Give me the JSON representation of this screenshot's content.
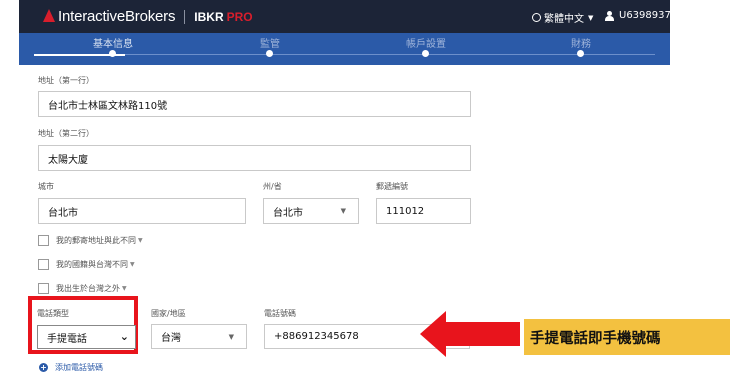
{
  "header": {
    "brand": "InteractiveBrokers",
    "product_a": "IBKR",
    "product_b": "PRO",
    "language": "繁體中文",
    "user_id": "U6398937"
  },
  "stepper": {
    "steps": [
      {
        "label": "基本信息",
        "state": "active"
      },
      {
        "label": "監管",
        "state": "pending"
      },
      {
        "label": "帳戶設置",
        "state": "pending"
      },
      {
        "label": "財務",
        "state": "pending"
      }
    ]
  },
  "form": {
    "address1": {
      "label": "地址（第一行）",
      "value": "台北市士林區文林路110號"
    },
    "address2": {
      "label": "地址（第二行）",
      "value": "太陽大廈"
    },
    "city": {
      "label": "城市",
      "value": "台北市"
    },
    "state": {
      "label": "州/省",
      "value": "台北市"
    },
    "postal": {
      "label": "郵遞編號",
      "value": "111012"
    },
    "checkboxes": [
      {
        "label": "我的郵寄地址與此不同",
        "checked": false
      },
      {
        "label": "我的國籍與台灣不同",
        "checked": false
      },
      {
        "label": "我出生於台灣之外",
        "checked": false
      }
    ],
    "phone_type": {
      "label": "電話類型",
      "value": "手提電話"
    },
    "country": {
      "label": "國家/地區",
      "value": "台灣"
    },
    "phone_number": {
      "label": "電話號碼",
      "value": "+886912345678"
    },
    "add_phone": "添加電話號碼"
  },
  "annotation": {
    "callout": "手提電話即手機號碼",
    "callout_color": "#f3c140",
    "highlight_color": "#e8141c"
  },
  "colors": {
    "header_bg": "#1c2437",
    "stepper_bg": "#2b5aa8",
    "brand_red": "#d81e2c"
  }
}
